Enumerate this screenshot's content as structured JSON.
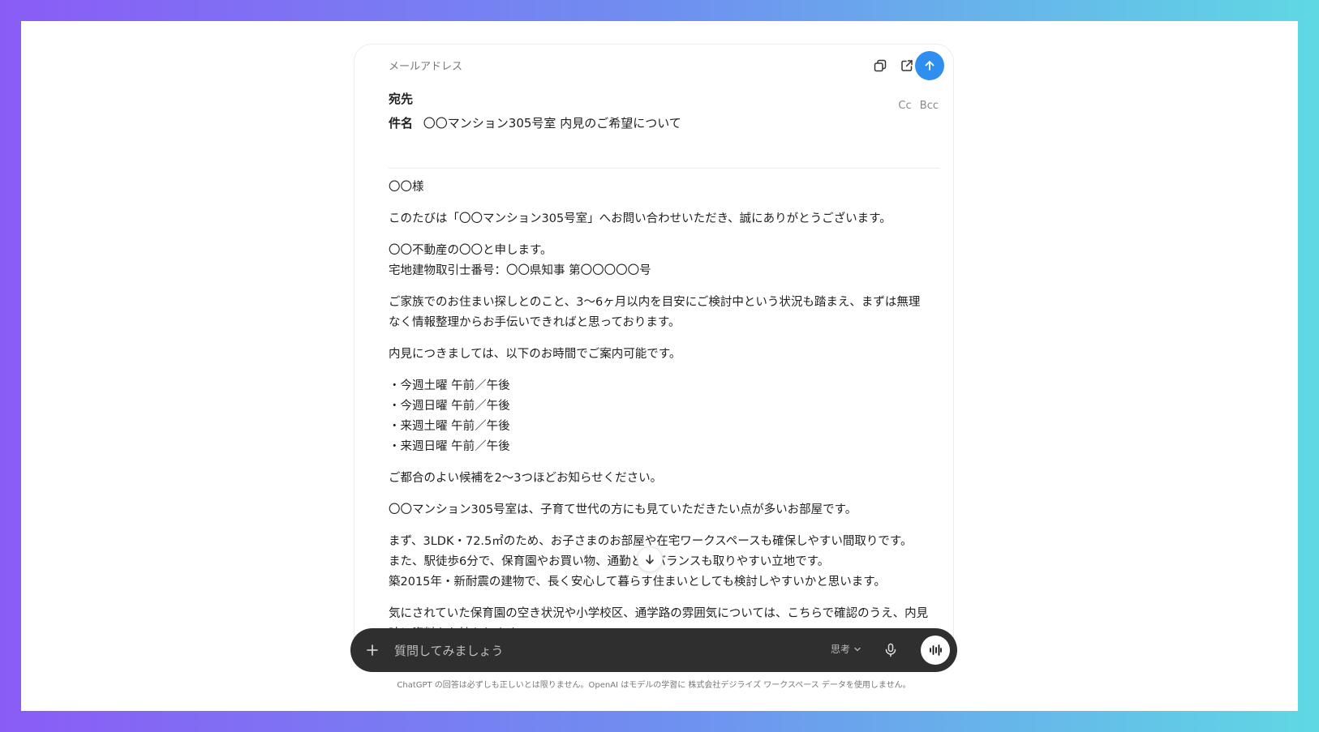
{
  "email": {
    "kind_label": "メールアドレス",
    "to_label": "宛先",
    "cc_label": "Cc",
    "bcc_label": "Bcc",
    "subject_label": "件名",
    "subject_value": "〇〇マンション305号室 内見のご希望について",
    "paragraphs": [
      "〇〇様",
      "このたびは「〇〇マンション305号室」へお問い合わせいただき、誠にありがとうございます。",
      "〇〇不動産の〇〇と申します。\n宅地建物取引士番号：〇〇県知事 第〇〇〇〇〇号",
      "ご家族でのお住まい探しとのこと、3〜6ヶ月以内を目安にご検討中という状況も踏まえ、まずは無理なく情報整理からお手伝いできればと思っております。",
      "内見につきましては、以下のお時間でご案内可能です。",
      "・今週土曜 午前／午後\n・今週日曜 午前／午後\n・来週土曜 午前／午後\n・来週日曜 午前／午後",
      "ご都合のよい候補を2〜3つほどお知らせください。",
      "〇〇マンション305号室は、子育て世代の方にも見ていただきたい点が多いお部屋です。",
      "まず、3LDK・72.5㎡のため、お子さまのお部屋や在宅ワークスペースも確保しやすい間取りです。\nまた、駅徒歩6分で、保育園やお買い物、通勤とのバランスも取りやすい立地です。\n築2015年・新耐震の建物で、長く安心して暮らす住まいとしても検討しやすいかと思います。",
      "気にされていた保育園の空き状況や小学校区、通学路の雰囲気については、こちらで確認のうえ、内見時に資料をお持ちします。"
    ]
  },
  "composer": {
    "placeholder": "質問してみましょう",
    "think_label": "思考"
  },
  "disclaimer": "ChatGPT の回答は必ずしも正しいとは限りません。OpenAI はモデルの学習に 株式会社デジライズ ワークスペース データを使用しません。",
  "colors": {
    "send_button": "#2f8ff0",
    "composer_bg": "#2f2f2f"
  }
}
